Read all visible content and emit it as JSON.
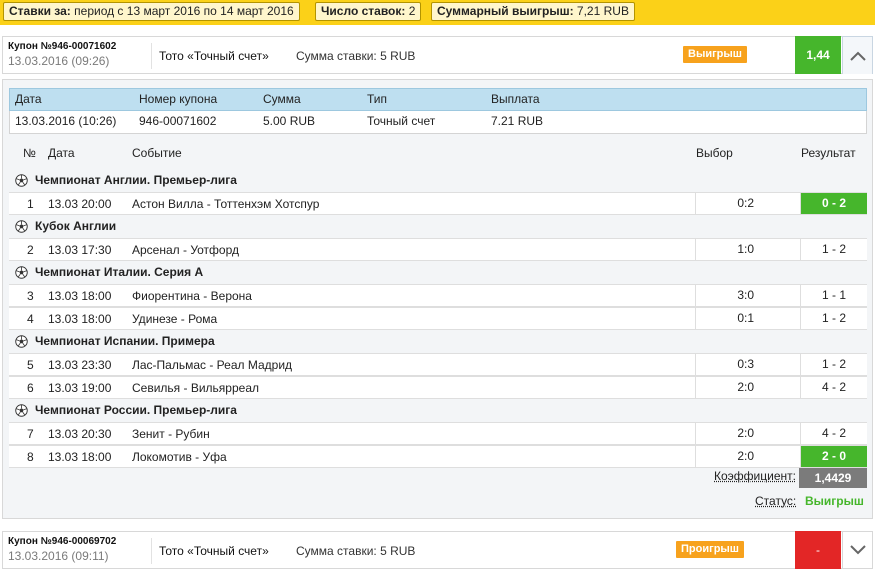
{
  "filters": {
    "bets_label": "Ставки за:",
    "bets_value": "период с 13 март 2016 по 14 март 2016",
    "count_label": "Число ставок:",
    "count_value": "2",
    "total_label": "Суммарный выигрыш:",
    "total_value": "7,21 RUB"
  },
  "coupons": [
    {
      "number": "Купон №946-00071602",
      "date": "13.03.2016 (09:26)",
      "game": "Тото «Точный счет»",
      "stake": "Сумма ставки: 5 RUB",
      "status_badge": "Выигрыш",
      "coef": "1,44",
      "toggle_icon": "chevron-up-icon"
    },
    {
      "number": "Купон №946-00069702",
      "date": "13.03.2016 (09:11)",
      "game": "Тото «Точный счет»",
      "stake": "Сумма ставки: 5 RUB",
      "status_badge": "Проигрыш",
      "coef": "-",
      "toggle_icon": "chevron-down-icon"
    }
  ],
  "details": {
    "headers": [
      "Дата",
      "Номер купона",
      "Сумма",
      "Тип",
      "Выплата"
    ],
    "row": [
      "13.03.2016 (10:26)",
      "946-00071602",
      "5.00 RUB",
      "Точный счет",
      "7.21 RUB"
    ],
    "event_headers": {
      "no": "№",
      "date": "Дата",
      "event": "Событие",
      "pick": "Выбор",
      "result": "Результат"
    },
    "leagues": [
      {
        "name": "Чемпионат Англии. Премьер-лига",
        "events": [
          {
            "no": "1",
            "date": "13.03 20:00",
            "event": "Астон Вилла - Тоттенхэм Хотспур",
            "pick": "0:2",
            "result": "0 - 2",
            "hit": true
          }
        ]
      },
      {
        "name": "Кубок Англии",
        "events": [
          {
            "no": "2",
            "date": "13.03 17:30",
            "event": "Арсенал - Уотфорд",
            "pick": "1:0",
            "result": "1 - 2",
            "hit": false
          }
        ]
      },
      {
        "name": "Чемпионат Италии. Серия А",
        "events": [
          {
            "no": "3",
            "date": "13.03 18:00",
            "event": "Фиорентина - Верона",
            "pick": "3:0",
            "result": "1 - 1",
            "hit": false
          },
          {
            "no": "4",
            "date": "13.03 18:00",
            "event": "Удинезе - Рома",
            "pick": "0:1",
            "result": "1 - 2",
            "hit": false
          }
        ]
      },
      {
        "name": "Чемпионат Испании. Примера",
        "events": [
          {
            "no": "5",
            "date": "13.03 23:30",
            "event": "Лас-Пальмас - Реал Мадрид",
            "pick": "0:3",
            "result": "1 - 2",
            "hit": false
          },
          {
            "no": "6",
            "date": "13.03 19:00",
            "event": "Севилья - Вильярреал",
            "pick": "2:0",
            "result": "4 - 2",
            "hit": false
          }
        ]
      },
      {
        "name": "Чемпионат России. Премьер-лига",
        "events": [
          {
            "no": "7",
            "date": "13.03 20:30",
            "event": "Зенит - Рубин",
            "pick": "2:0",
            "result": "4 - 2",
            "hit": false
          },
          {
            "no": "8",
            "date": "13.03 18:00",
            "event": "Локомотив - Уфа",
            "pick": "2:0",
            "result": "2 - 0",
            "hit": true
          }
        ]
      }
    ],
    "coef_label": "Коэффициент:",
    "coef_value": "1,4429",
    "status_label": "Статус:",
    "status_value": "Выигрыш"
  },
  "colors": {
    "topbar": "#fbd118",
    "win_green": "#46b62c",
    "lose_red": "#e32626",
    "badge_orange": "#f7a21d",
    "header_blue": "#bedff0"
  }
}
